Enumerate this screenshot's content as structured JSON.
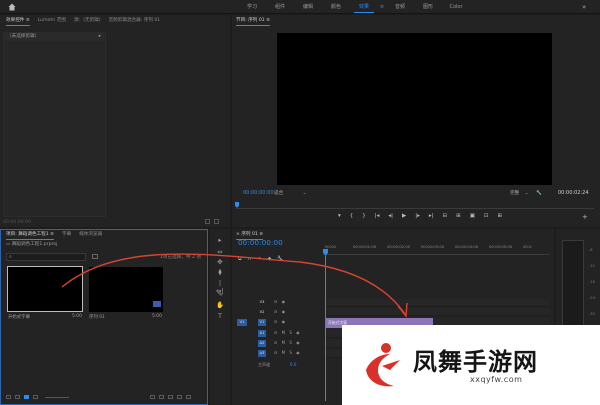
{
  "topbar": {
    "workspaces": [
      "学习",
      "组件",
      "编辑",
      "颜色",
      "效果",
      "音频",
      "图形",
      "Color"
    ],
    "active_workspace": "效果",
    "more_label": "»"
  },
  "source_panel": {
    "tabs": [
      "效果控件 ≡",
      "Lumetri 范围",
      "源：(无剪辑)",
      "音频剪辑混合器: 序列 01"
    ],
    "dropdown": "（未选择剪辑）",
    "timecode": "00:00:00:00"
  },
  "program_monitor": {
    "tab": "节目: 序列 01 ≡",
    "timecode": "00:00:00:00",
    "fit": "适合",
    "quality": "完整",
    "duration": "00:00:02:24",
    "controls": [
      "▾",
      "{",
      "}",
      "|◂",
      "◂|",
      "▶",
      "|▸",
      "▸|",
      "⊟",
      "⊞",
      "▣",
      "⊡",
      "⊞"
    ],
    "add": "+"
  },
  "project_panel": {
    "tabs": [
      "项目: 舞蹈调色工程1 ≡",
      "字幕",
      "媒体浏览器"
    ],
    "path": "舞蹈调色工程1.prproj",
    "selection": "1项已选择，共 2 项",
    "clips": [
      {
        "name": "开始式字幕",
        "duration": "5:00"
      },
      {
        "name": "序列 01",
        "duration": "5:00"
      }
    ]
  },
  "tools": [
    "▸",
    "⇔",
    "✥",
    "⧫",
    "|↔|",
    "✎",
    "✋",
    "T"
  ],
  "timeline": {
    "tab": "序列 01 ≡",
    "timecode": "00:00:00:00",
    "ruler": [
      "00:00",
      "00:00:01:00",
      "00:00:02:00",
      "00:00:03:00",
      "00:00:04:00",
      "00:00:05:00",
      "00:0"
    ],
    "tracks": [
      {
        "target": "",
        "name": "V3",
        "controls": "⊟ ◉",
        "on": false
      },
      {
        "target": "",
        "name": "V2",
        "controls": "⊟ ◉",
        "on": false
      },
      {
        "target": "V1",
        "name": "V1",
        "controls": "⊟ ◉",
        "on": true
      },
      {
        "target": "",
        "name": "A1",
        "controls": "⊟ M S ◉",
        "on": true
      },
      {
        "target": "",
        "name": "A2",
        "controls": "⊟ M S ◉",
        "on": true
      },
      {
        "target": "",
        "name": "A3",
        "controls": "⊟ M S ◉",
        "on": true
      }
    ],
    "clip_label": "开始式字幕",
    "master_label": "主声道",
    "master_value": "0.0"
  },
  "meters": {
    "labels": [
      "-6",
      "-12",
      "-18",
      "-24",
      "-30",
      "-36",
      "-42"
    ]
  },
  "watermark": {
    "title": "凤舞手游网",
    "url": "xxqyfw.com"
  },
  "colors": {
    "accent": "#2d8ceb",
    "clip": "#8a76b8",
    "annotation": "#d9432f"
  }
}
